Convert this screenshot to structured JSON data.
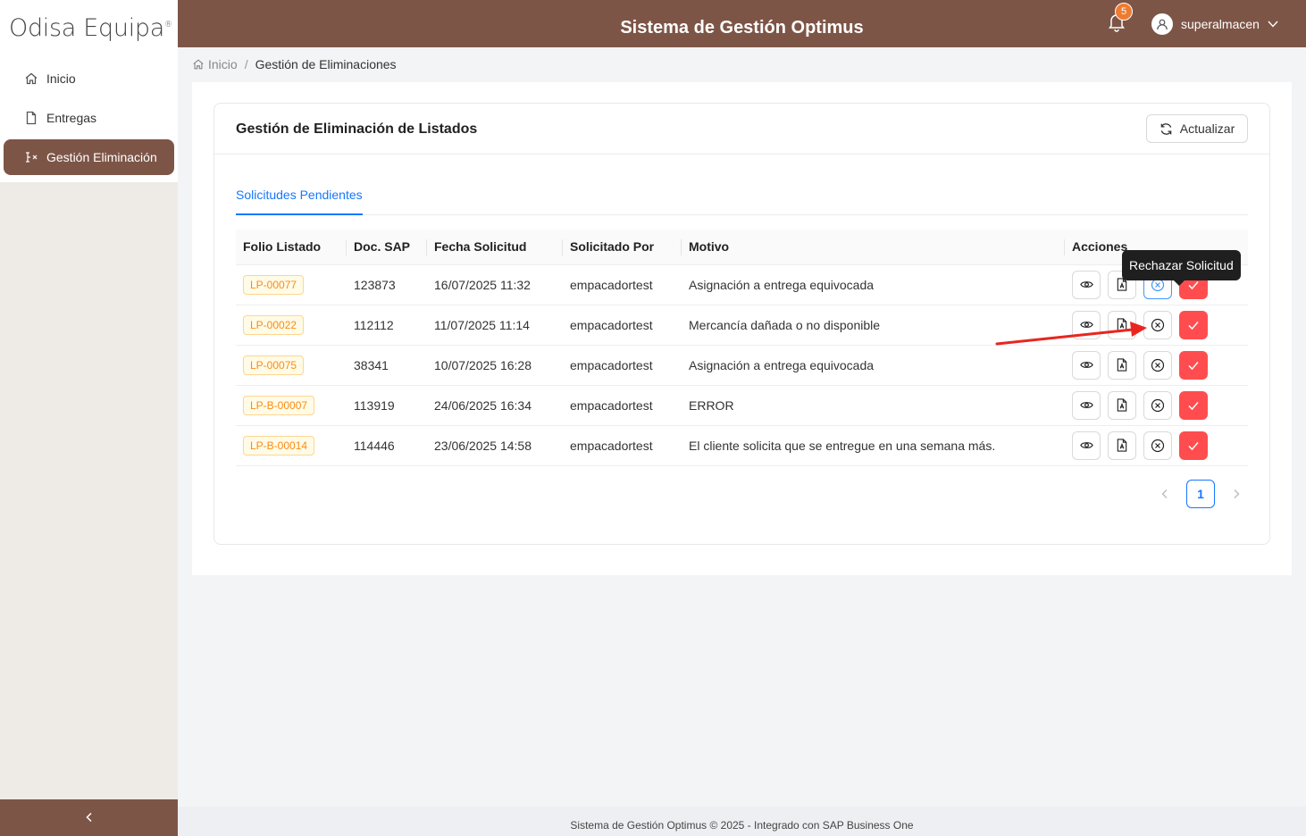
{
  "app": {
    "logo_text": "Odisa Equipa",
    "logo_mark": "®",
    "title": "Sistema de Gestión Optimus",
    "notifications_count": "5",
    "username": "superalmacen"
  },
  "sidebar": {
    "items": [
      {
        "label": "Inicio",
        "icon": "home-icon"
      },
      {
        "label": "Entregas",
        "icon": "file-icon"
      },
      {
        "label": "Gestión Eliminación",
        "icon": "delete-list-icon",
        "active": true
      }
    ]
  },
  "breadcrumb": {
    "home": "Inicio",
    "separator": "/",
    "current": "Gestión de Eliminaciones"
  },
  "card": {
    "title": "Gestión de Eliminación de Listados",
    "refresh_label": "Actualizar"
  },
  "tabs": [
    {
      "label": "Solicitudes Pendientes",
      "active": true
    }
  ],
  "table": {
    "headers": [
      "Folio Listado",
      "Doc. SAP",
      "Fecha Solicitud",
      "Solicitado Por",
      "Motivo",
      "Acciones"
    ],
    "rows": [
      {
        "folio": "LP-00077",
        "doc_sap": "123873",
        "fecha": "16/07/2025 11:32",
        "solicitado_por": "empacadortest",
        "motivo": "Asignación a entrega equivocada"
      },
      {
        "folio": "LP-00022",
        "doc_sap": "112112",
        "fecha": "11/07/2025 11:14",
        "solicitado_por": "empacadortest",
        "motivo": "Mercancía dañada o no disponible"
      },
      {
        "folio": "LP-00075",
        "doc_sap": "38341",
        "fecha": "10/07/2025 16:28",
        "solicitado_por": "empacadortest",
        "motivo": "Asignación a entrega equivocada"
      },
      {
        "folio": "LP-B-00007",
        "doc_sap": "113919",
        "fecha": "24/06/2025 16:34",
        "solicitado_por": "empacadortest",
        "motivo": "ERROR"
      },
      {
        "folio": "LP-B-00014",
        "doc_sap": "114446",
        "fecha": "23/06/2025 14:58",
        "solicitado_por": "empacadortest",
        "motivo": "El cliente solicita que se entregue en una semana más."
      }
    ]
  },
  "tooltip": {
    "text": "Rechazar Solicitud"
  },
  "pagination": {
    "current_page": "1"
  },
  "footer": {
    "text": "Sistema de Gestión Optimus © 2025 - Integrado con SAP Business One"
  },
  "colors": {
    "brand": "#7d5547",
    "accent": "#1677ff",
    "danger": "#ff4d4f",
    "badge": "#ee7b2f",
    "tag": "#fa8c16"
  }
}
